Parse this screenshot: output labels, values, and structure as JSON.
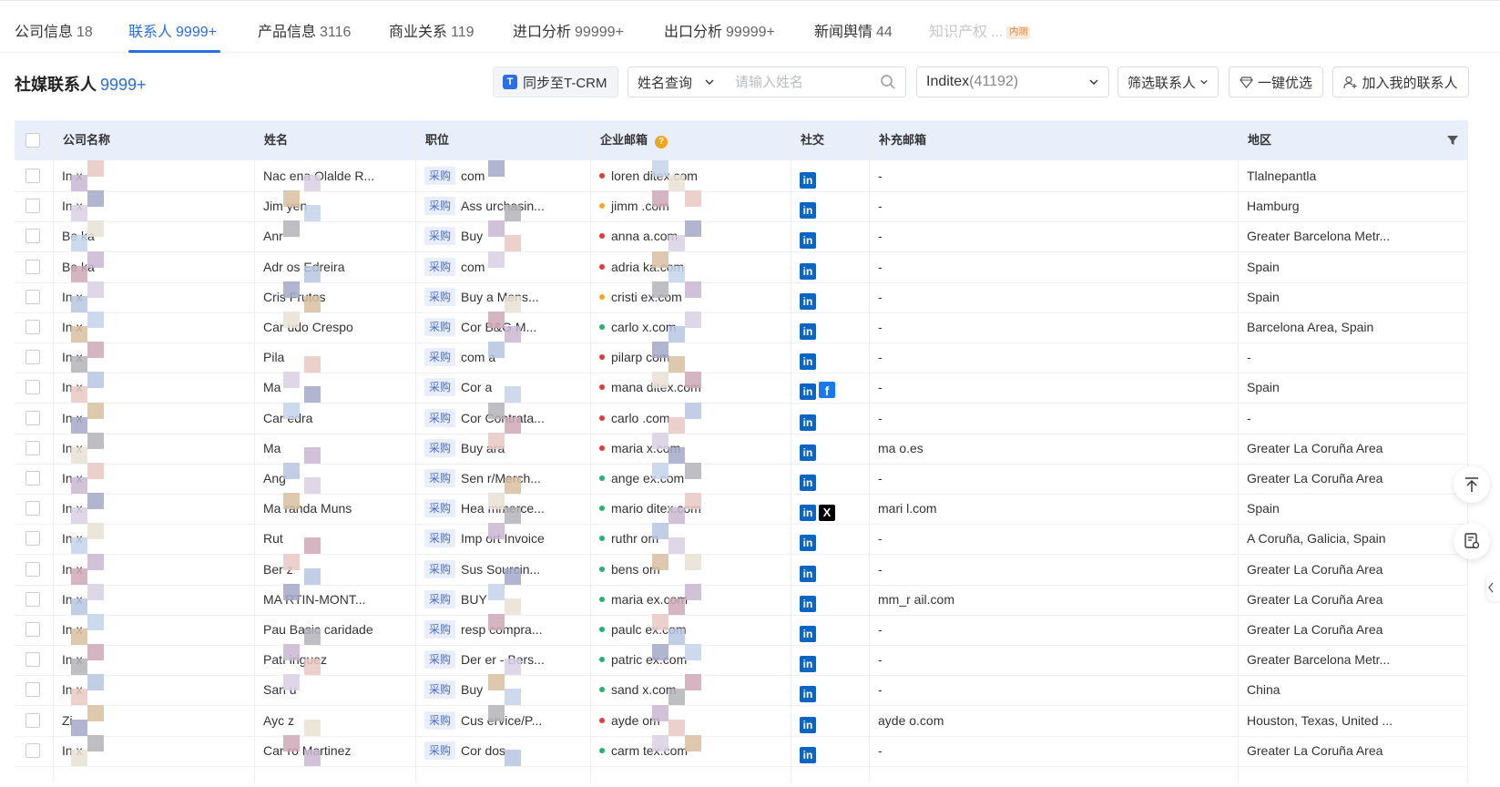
{
  "tabs": [
    {
      "label": "公司信息",
      "count": "18",
      "state": "normal"
    },
    {
      "label": "联系人",
      "count": "9999+",
      "state": "active"
    },
    {
      "label": "产品信息",
      "count": "3116",
      "state": "normal"
    },
    {
      "label": "商业关系",
      "count": "119",
      "state": "normal"
    },
    {
      "label": "进口分析",
      "count": "99999+",
      "state": "normal"
    },
    {
      "label": "出口分析",
      "count": "99999+",
      "state": "normal"
    },
    {
      "label": "新闻舆情",
      "count": "44",
      "state": "normal"
    },
    {
      "label": "知识产权",
      "count": "...",
      "state": "disabled",
      "badge": "内测"
    }
  ],
  "toolbar": {
    "title": "社媒联系人",
    "title_count": "9999+",
    "sync_logo": "T",
    "sync_label": "同步至T-CRM",
    "name_query_label": "姓名查询",
    "search_placeholder": "请输入姓名",
    "company_name": "Inditex",
    "company_count": "(41192)",
    "filter_label": "筛选联系人",
    "best_label": "一键优选",
    "add_label": "加入我的联系人"
  },
  "columns": [
    "公司名称",
    "姓名",
    "职位",
    "企业邮箱",
    "社交",
    "补充邮箱",
    "地区"
  ],
  "icons": {
    "linkedin": "in",
    "facebook": "f",
    "x": "X",
    "help": "?"
  },
  "colors": {
    "accent": "#2b6ee8",
    "dot_red": "#e03c3c",
    "dot_green": "#27b36a",
    "dot_orange": "#f5a623",
    "linkedin": "#0a66c2"
  },
  "rows": [
    {
      "company": "In   x",
      "name": "Nac        ena Olalde R...",
      "tag": "采购",
      "position": "com",
      "email": "loren              ditex.com",
      "dot": "red",
      "social": [
        "linkedin"
      ],
      "extra_email": "-",
      "region": "Tlalnepantla"
    },
    {
      "company": "In   x",
      "name": "Jim          yen",
      "tag": "采购",
      "position": "Ass        urchasin...",
      "email": "jimm               .com",
      "dot": "orange",
      "social": [
        "linkedin"
      ],
      "extra_email": "-",
      "region": "Hamburg"
    },
    {
      "company": "Be   ka",
      "name": "Anr",
      "tag": "采购",
      "position": "Buy",
      "email": "anna              a.com",
      "dot": "red",
      "social": [
        "linkedin"
      ],
      "extra_email": "-",
      "region": "Greater Barcelona Metr..."
    },
    {
      "company": "Be   ka",
      "name": "Adr         os Edreira",
      "tag": "采购",
      "position": "com",
      "email": "adria              ka.com",
      "dot": "red",
      "social": [
        "linkedin"
      ],
      "extra_email": "-",
      "region": "Spain"
    },
    {
      "company": "In   x",
      "name": "Cris        Frutos",
      "tag": "采购",
      "position": "Buy        a Mens...",
      "email": "cristi              ex.com",
      "dot": "orange",
      "social": [
        "linkedin"
      ],
      "extra_email": "-",
      "region": "Spain"
    },
    {
      "company": "In   x",
      "name": "Car          udo Crespo",
      "tag": "采购",
      "position": "Cor        B&G M...",
      "email": "carlo              x.com",
      "dot": "green",
      "social": [
        "linkedin"
      ],
      "extra_email": "-",
      "region": "Barcelona Area, Spain"
    },
    {
      "company": "In   x",
      "name": "Pila",
      "tag": "采购",
      "position": "com          a",
      "email": "pilarp              com",
      "dot": "red",
      "social": [
        "linkedin"
      ],
      "extra_email": "-",
      "region": "-"
    },
    {
      "company": "In   x",
      "name": "Ma",
      "tag": "采购",
      "position": "Cor          a",
      "email": "mana              ditex.com",
      "dot": "red",
      "social": [
        "linkedin",
        "facebook"
      ],
      "extra_email": "-",
      "region": "Spain"
    },
    {
      "company": "In   x",
      "name": "Car         edra",
      "tag": "采购",
      "position": "Cor        Contrata...",
      "email": "carlo              .com",
      "dot": "red",
      "social": [
        "linkedin"
      ],
      "extra_email": "-",
      "region": "-"
    },
    {
      "company": "In   x",
      "name": "Ma",
      "tag": "采购",
      "position": "Buy          ara",
      "email": "maria              x.com",
      "dot": "red",
      "social": [
        "linkedin"
      ],
      "extra_email": "ma                  o.es",
      "region": "Greater La Coruña Area"
    },
    {
      "company": "In   x",
      "name": "Ang",
      "tag": "采购",
      "position": "Sen        r/Merch...",
      "email": "ange              ex.com",
      "dot": "green",
      "social": [
        "linkedin"
      ],
      "extra_email": "-",
      "region": "Greater La Coruña Area"
    },
    {
      "company": "In   x",
      "name": "Ma        randa Muns",
      "tag": "采购",
      "position": "Hea        mmerce...",
      "email": "mario              ditex.com",
      "dot": "green",
      "social": [
        "linkedin",
        "x"
      ],
      "extra_email": "mari                  l.com",
      "region": "Spain"
    },
    {
      "company": "In   x",
      "name": "Rut",
      "tag": "采购",
      "position": "Imp        ort Invoice",
      "email": "ruthr              om",
      "dot": "green",
      "social": [
        "linkedin"
      ],
      "extra_email": "-",
      "region": "A Coruña, Galicia, Spain"
    },
    {
      "company": "In   x",
      "name": "Ber          z",
      "tag": "采购",
      "position": "Sus        Sourcin...",
      "email": "bens              om",
      "dot": "green",
      "social": [
        "linkedin"
      ],
      "extra_email": "-",
      "region": "Greater La Coruña Area"
    },
    {
      "company": "In   x",
      "name": "MA        RTIN-MONT...",
      "tag": "采购",
      "position": "BUY",
      "email": "maria              ex.com",
      "dot": "green",
      "social": [
        "linkedin"
      ],
      "extra_email": "mm_r                  ail.com",
      "region": "Greater La Coruña Area"
    },
    {
      "company": "In   x",
      "name": "Pau        Basic caridade",
      "tag": "采购",
      "position": "resp        compra...",
      "email": "paulc              ex.com",
      "dot": "green",
      "social": [
        "linkedin"
      ],
      "extra_email": "-",
      "region": "Greater La Coruña Area"
    },
    {
      "company": "In   x",
      "name": "Patı        iriguez",
      "tag": "采购",
      "position": "Der        er - Bers...",
      "email": "patric              ex.com",
      "dot": "green",
      "social": [
        "linkedin"
      ],
      "extra_email": "-",
      "region": "Greater Barcelona Metr..."
    },
    {
      "company": "In   x",
      "name": "San          u",
      "tag": "采购",
      "position": "Buy",
      "email": "sand              x.com",
      "dot": "green",
      "social": [
        "linkedin"
      ],
      "extra_email": "-",
      "region": "China"
    },
    {
      "company": "Zi",
      "name": "Ayc          z",
      "tag": "采购",
      "position": "Cus        ervice/P...",
      "email": "ayde              om",
      "dot": "red",
      "social": [
        "linkedin"
      ],
      "extra_email": "ayde                  o.com",
      "region": "Houston, Texas, United ..."
    },
    {
      "company": "In   x",
      "name": "Car        ro Martinez",
      "tag": "采购",
      "position": "Cor        dos",
      "email": "carm              tex.com",
      "dot": "green",
      "social": [
        "linkedin"
      ],
      "extra_email": "-",
      "region": "Greater La Coruña Area"
    }
  ]
}
